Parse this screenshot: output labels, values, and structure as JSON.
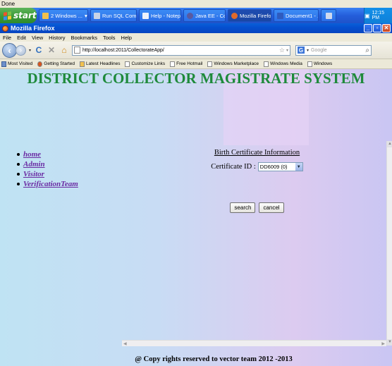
{
  "status": {
    "text": "Done"
  },
  "taskbar": {
    "start_label": "start",
    "items": [
      {
        "label": "2 Windows ...",
        "icon": "folder-icon",
        "color": "#f2c14e"
      },
      {
        "label": "Run SQL Com...",
        "icon": "sql-icon",
        "color": "#c7d3e6"
      },
      {
        "label": "Help - Notepad",
        "icon": "notepad-icon",
        "color": "#eef3fb"
      },
      {
        "label": "Java EE - Coll...",
        "icon": "eclipse-icon",
        "color": "#5a5aa0"
      },
      {
        "label": "Mozilla Firefox",
        "icon": "firefox-icon",
        "color": "#e06a2b"
      },
      {
        "label": "Document1 - ...",
        "icon": "word-icon",
        "color": "#2f5bbf"
      }
    ],
    "clock": "12:15 PM"
  },
  "window": {
    "title": "Mozilla Firefox"
  },
  "menu": {
    "items": [
      "File",
      "Edit",
      "View",
      "History",
      "Bookmarks",
      "Tools",
      "Help"
    ]
  },
  "navbar": {
    "url": "http://localhost:2011/CollectorateApp/",
    "search_placeholder": "Google"
  },
  "bookmarks": {
    "items": [
      "Most Visited",
      "Getting Started",
      "Latest Headlines",
      "Customize Links",
      "Free Hotmail",
      "Windows Marketplace",
      "Windows Media",
      "Windows"
    ]
  },
  "page": {
    "title": "DISTRICT COLLECTOR MAGISTRATE SYSTEM",
    "nav": [
      "home",
      "Admin",
      "Visitor",
      "VerificationTeam"
    ],
    "form_heading": "Birth Certificate Information",
    "cert_label": "Certificate ID :",
    "cert_value": "DD6009 (0)",
    "search_button": "search",
    "cancel_button": "cancel",
    "footer": "@ Copy rights reserved to vector team 2012 -2013"
  }
}
